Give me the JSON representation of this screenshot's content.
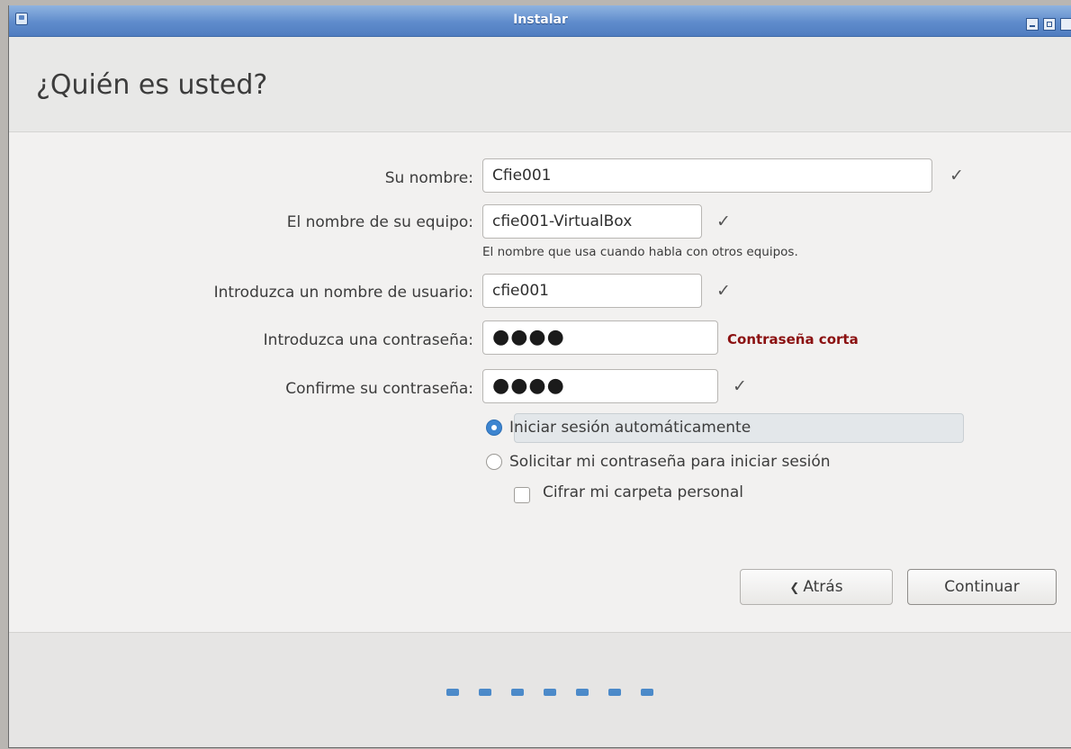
{
  "window": {
    "title": "Instalar",
    "buttons": [
      "minimize-icon",
      "maximize-icon",
      "close-icon"
    ]
  },
  "page": {
    "title": "¿Quién es usted?"
  },
  "form": {
    "name_label": "Su nombre:",
    "name_value": "Cfie001",
    "computer_label": "El nombre de su equipo:",
    "computer_value": "cfie001-VirtualBox",
    "computer_hint": "El nombre que usa cuando habla con otros equipos.",
    "username_label": "Introduzca un nombre de usuario:",
    "username_value": "cfie001",
    "password_label": "Introduzca una contraseña:",
    "password_mask": "●●●●",
    "password_warning": "Contraseña corta",
    "confirm_label": "Confirme su contraseña:",
    "confirm_mask": "●●●●",
    "check_glyph": "✓"
  },
  "login": {
    "auto_label": "Iniciar sesión automáticamente",
    "auto_selected": true,
    "ask_label": "Solicitar mi contraseña para iniciar sesión",
    "ask_selected": false,
    "encrypt_label": "Cifrar mi carpeta personal",
    "encrypt_checked": false
  },
  "buttons": {
    "back_icon": "chevron-left-icon",
    "back_label": "Atrás",
    "continue_label": "Continuar"
  },
  "progress": {
    "steps_total": 7,
    "accent": "#4c8ac9"
  },
  "colors": {
    "warning": "#8b1111",
    "titlebar": "#5f8ccc"
  }
}
